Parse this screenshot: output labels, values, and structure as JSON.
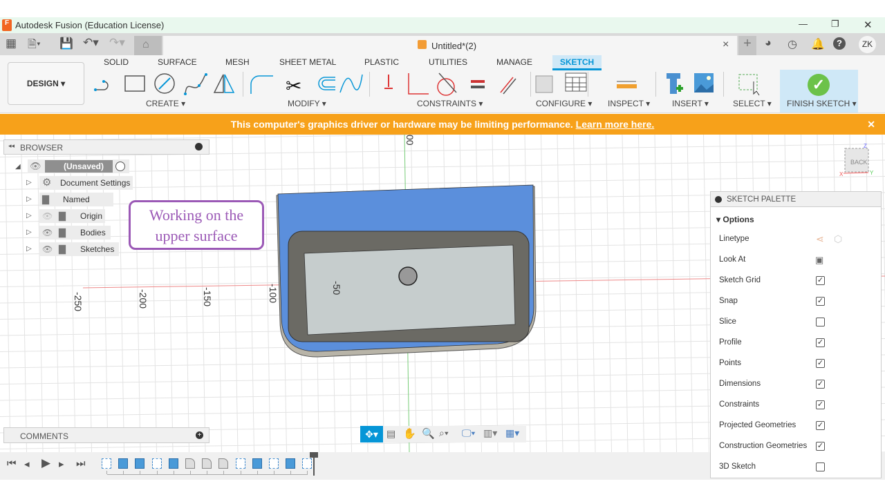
{
  "window": {
    "title": "Autodesk Fusion (Education License)",
    "minimize": "—",
    "restore": "❐",
    "close": "✕"
  },
  "doc_tab": {
    "title": "Untitled*(2)",
    "close": "×"
  },
  "header": {
    "user_initials": "ZK"
  },
  "toolbar": {
    "workspace": "DESIGN",
    "tabs": [
      "SOLID",
      "SURFACE",
      "MESH",
      "SHEET METAL",
      "PLASTIC",
      "UTILITIES",
      "MANAGE",
      "SKETCH"
    ],
    "active_tab": "SKETCH",
    "groups": [
      "CREATE",
      "MODIFY",
      "CONSTRAINTS",
      "CONFIGURE",
      "INSPECT",
      "INSERT",
      "SELECT",
      "FINISH SKETCH"
    ]
  },
  "banner": {
    "message": "This computer's graphics driver or hardware may be limiting performance.",
    "link": "Learn more here.",
    "close": "✕"
  },
  "browser": {
    "title": "BROWSER",
    "root": "(Unsaved)",
    "items": [
      "Document Settings",
      "Named Views",
      "Origin",
      "Bodies",
      "Sketches"
    ]
  },
  "callout": {
    "line1": "Working on the",
    "line2": "upper surface"
  },
  "axis_labels": {
    "x": [
      "-250",
      "-200",
      "-150",
      "-100",
      "-50"
    ],
    "top": "00"
  },
  "viewcube": {
    "face": "BACK",
    "x": "X",
    "y": "Y",
    "z": "Z"
  },
  "comments": {
    "title": "COMMENTS"
  },
  "palette": {
    "title": "SKETCH PALETTE",
    "section": "Options",
    "rows": [
      {
        "label": "Linetype",
        "type": "icons"
      },
      {
        "label": "Look At",
        "type": "icon"
      },
      {
        "label": "Sketch Grid",
        "checked": true
      },
      {
        "label": "Snap",
        "checked": true
      },
      {
        "label": "Slice",
        "checked": false
      },
      {
        "label": "Profile",
        "checked": true
      },
      {
        "label": "Points",
        "checked": true
      },
      {
        "label": "Dimensions",
        "checked": true
      },
      {
        "label": "Constraints",
        "checked": true
      },
      {
        "label": "Projected Geometries",
        "checked": true
      },
      {
        "label": "Construction Geometries",
        "checked": true
      },
      {
        "label": "3D Sketch",
        "checked": false
      }
    ]
  },
  "timeline": {
    "features": [
      "sketch",
      "extrude",
      "extrude",
      "sketch",
      "extrude",
      "fillet",
      "fillet",
      "fillet",
      "sketch",
      "extrude",
      "sketch",
      "extrude",
      "sketch"
    ]
  },
  "colors": {
    "accent": "#0696d7",
    "banner": "#f7a11a",
    "selected_face": "#5b8fdc",
    "callout": "#9b59b6",
    "finish": "#6cc24a"
  }
}
